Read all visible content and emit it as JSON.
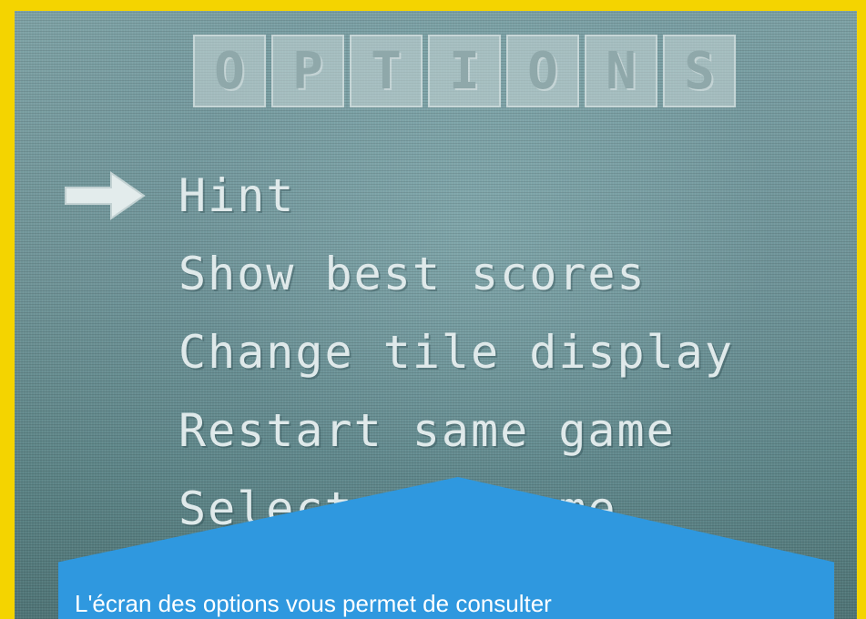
{
  "title_letters": [
    "O",
    "P",
    "T",
    "I",
    "O",
    "N",
    "S"
  ],
  "menu": {
    "items": [
      "Hint",
      "Show best scores",
      "Change tile display",
      "Restart same game",
      "Select new game"
    ],
    "selected_index": 0,
    "cursor_icon": "arrow-right-icon"
  },
  "caption": "L'écran des options vous permet de consulter",
  "colors": {
    "frame": "#f4d400",
    "caption_panel": "#2f98df",
    "menu_text": "#dfe9ea"
  }
}
